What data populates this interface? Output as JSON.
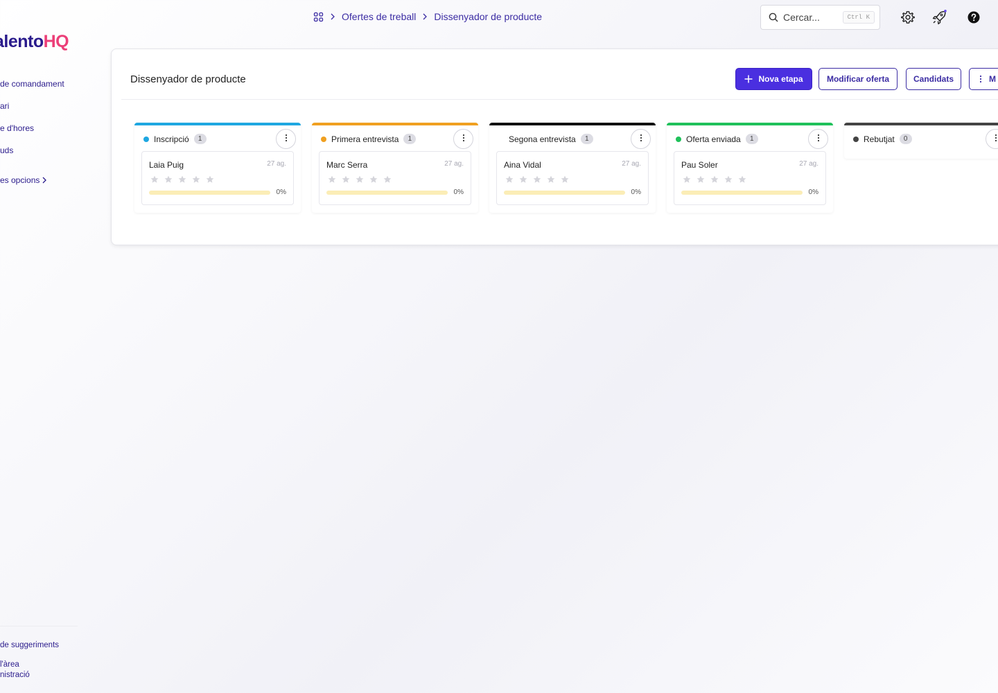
{
  "sidebar": {
    "logo_part1": "alento",
    "logo_part2": "HQ",
    "nav": [
      {
        "label": "de comandament"
      },
      {
        "label": "ari"
      },
      {
        "label": "e d'hores"
      },
      {
        "label": "uds"
      }
    ],
    "more_label": "es opcions",
    "suggestions_label": "de suggeriments",
    "admin_line1": "l'àrea",
    "admin_line2": "nistració"
  },
  "header": {
    "breadcrumb": {
      "home_icon": "grid-icon",
      "items": [
        "Ofertes de treball",
        "Dissenyador de producte"
      ]
    },
    "search": {
      "placeholder": "Cercar...",
      "shortcut": "Ctrl K"
    },
    "icons": [
      "gear-icon",
      "rocket-icon",
      "help-icon"
    ],
    "accent_color": "#3b2ca3"
  },
  "panel": {
    "title": "Dissenyador de producte",
    "buttons": {
      "new_stage": "Nova etapa",
      "edit_offer": "Modificar oferta",
      "candidates": "Candidats",
      "more": "M"
    },
    "columns": [
      {
        "name": "Inscripció",
        "count": "1",
        "color": "#1ea7e1",
        "dot": true,
        "cards": [
          {
            "name": "Laia Puig",
            "date": "27 ag.",
            "progress": 0,
            "progress_label": "0%",
            "rating": 0
          }
        ]
      },
      {
        "name": "Primera entrevista",
        "count": "1",
        "color": "#f0a020",
        "dot": true,
        "cards": [
          {
            "name": "Marc Serra",
            "date": "27 ag.",
            "progress": 0,
            "progress_label": "0%",
            "rating": 0
          }
        ]
      },
      {
        "name": "Segona entrevista",
        "count": "1",
        "color": "#111111",
        "dot": false,
        "cards": [
          {
            "name": "Aina Vidal",
            "date": "27 ag.",
            "progress": 0,
            "progress_label": "0%",
            "rating": 0
          }
        ]
      },
      {
        "name": "Oferta enviada",
        "count": "1",
        "color": "#1fc15a",
        "dot": true,
        "cards": [
          {
            "name": "Pau Soler",
            "date": "27 ag.",
            "progress": 0,
            "progress_label": "0%",
            "rating": 0
          }
        ]
      },
      {
        "name": "Rebutjat",
        "count": "0",
        "color": "#444444",
        "dot": true,
        "cards": []
      }
    ]
  }
}
